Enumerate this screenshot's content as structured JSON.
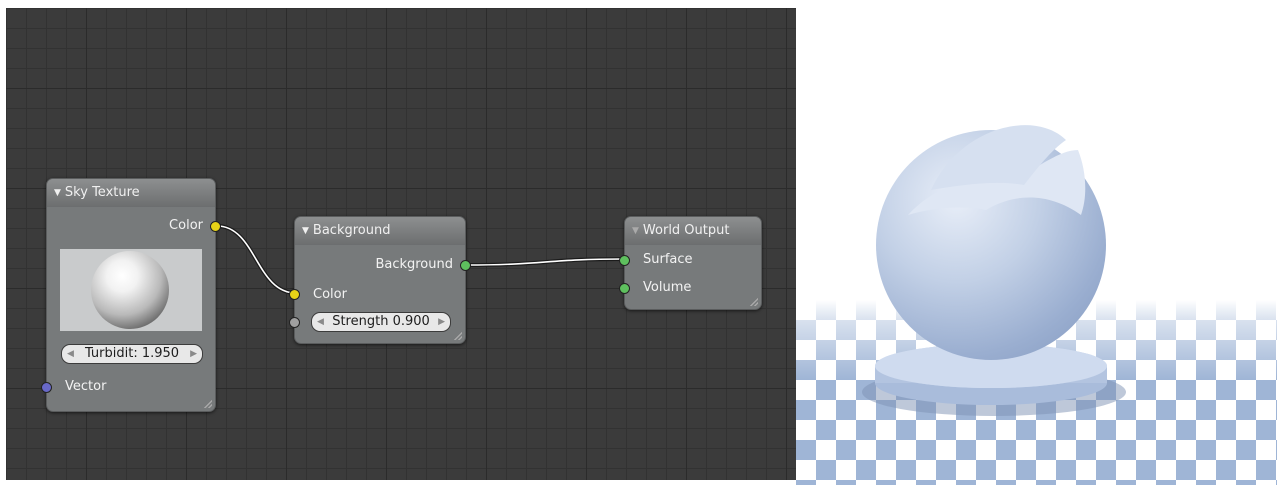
{
  "node_editor": {
    "sky_texture": {
      "title": "Sky Texture",
      "output_color_label": "Color",
      "turbidity_field": "Turbidit: 1.950",
      "input_vector_label": "Vector"
    },
    "background": {
      "title": "Background",
      "output_background_label": "Background",
      "input_color_label": "Color",
      "strength_field": "Strength 0.900"
    },
    "world_output": {
      "title": "World Output",
      "input_surface_label": "Surface",
      "input_volume_label": "Volume"
    }
  },
  "colors": {
    "socket_color": "#e8d317",
    "socket_shader": "#5ec05e",
    "socket_value": "#a0a0a0",
    "socket_vector": "#6868c8"
  }
}
